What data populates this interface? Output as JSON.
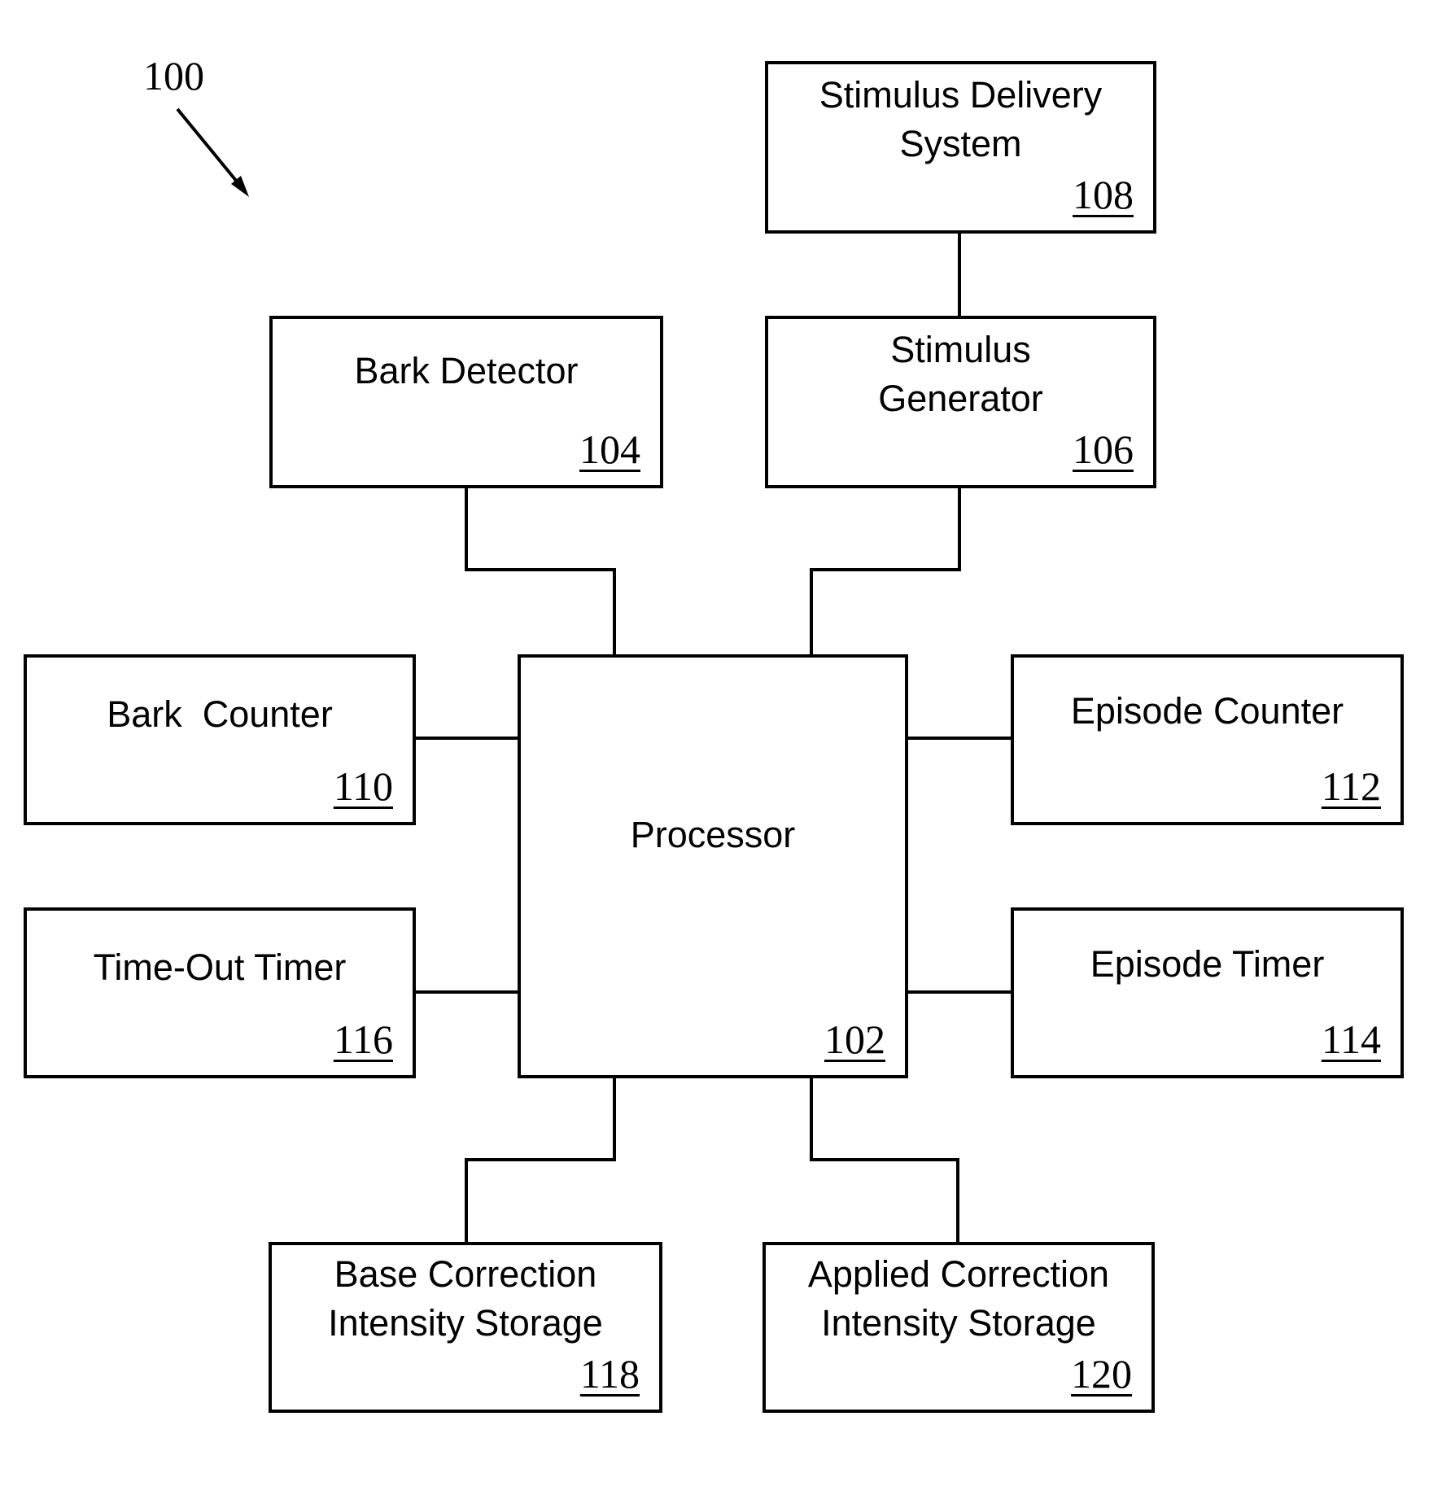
{
  "figure": {
    "label": "100",
    "line_color": "#000000",
    "background": "#ffffff"
  },
  "blocks": {
    "stimulus_delivery": {
      "title": "Stimulus Delivery\nSystem",
      "ref": "108"
    },
    "bark_detector": {
      "title": "Bark Detector",
      "ref": "104"
    },
    "stimulus_generator": {
      "title": "Stimulus\nGenerator",
      "ref": "106"
    },
    "bark_counter": {
      "title": "Bark  Counter",
      "ref": "110"
    },
    "processor": {
      "title": "Processor",
      "ref": "102"
    },
    "episode_counter": {
      "title": "Episode Counter",
      "ref": "112"
    },
    "time_out_timer": {
      "title": "Time-Out Timer",
      "ref": "116"
    },
    "episode_timer": {
      "title": "Episode Timer",
      "ref": "114"
    },
    "base_correction": {
      "title": "Base Correction\nIntensity Storage",
      "ref": "118"
    },
    "applied_correction": {
      "title": "Applied Correction\nIntensity Storage",
      "ref": "120"
    }
  },
  "connections": [
    [
      "stimulus_delivery",
      "stimulus_generator"
    ],
    [
      "bark_detector",
      "processor"
    ],
    [
      "stimulus_generator",
      "processor"
    ],
    [
      "bark_counter",
      "processor"
    ],
    [
      "episode_counter",
      "processor"
    ],
    [
      "time_out_timer",
      "processor"
    ],
    [
      "episode_timer",
      "processor"
    ],
    [
      "processor",
      "base_correction"
    ],
    [
      "processor",
      "applied_correction"
    ]
  ]
}
